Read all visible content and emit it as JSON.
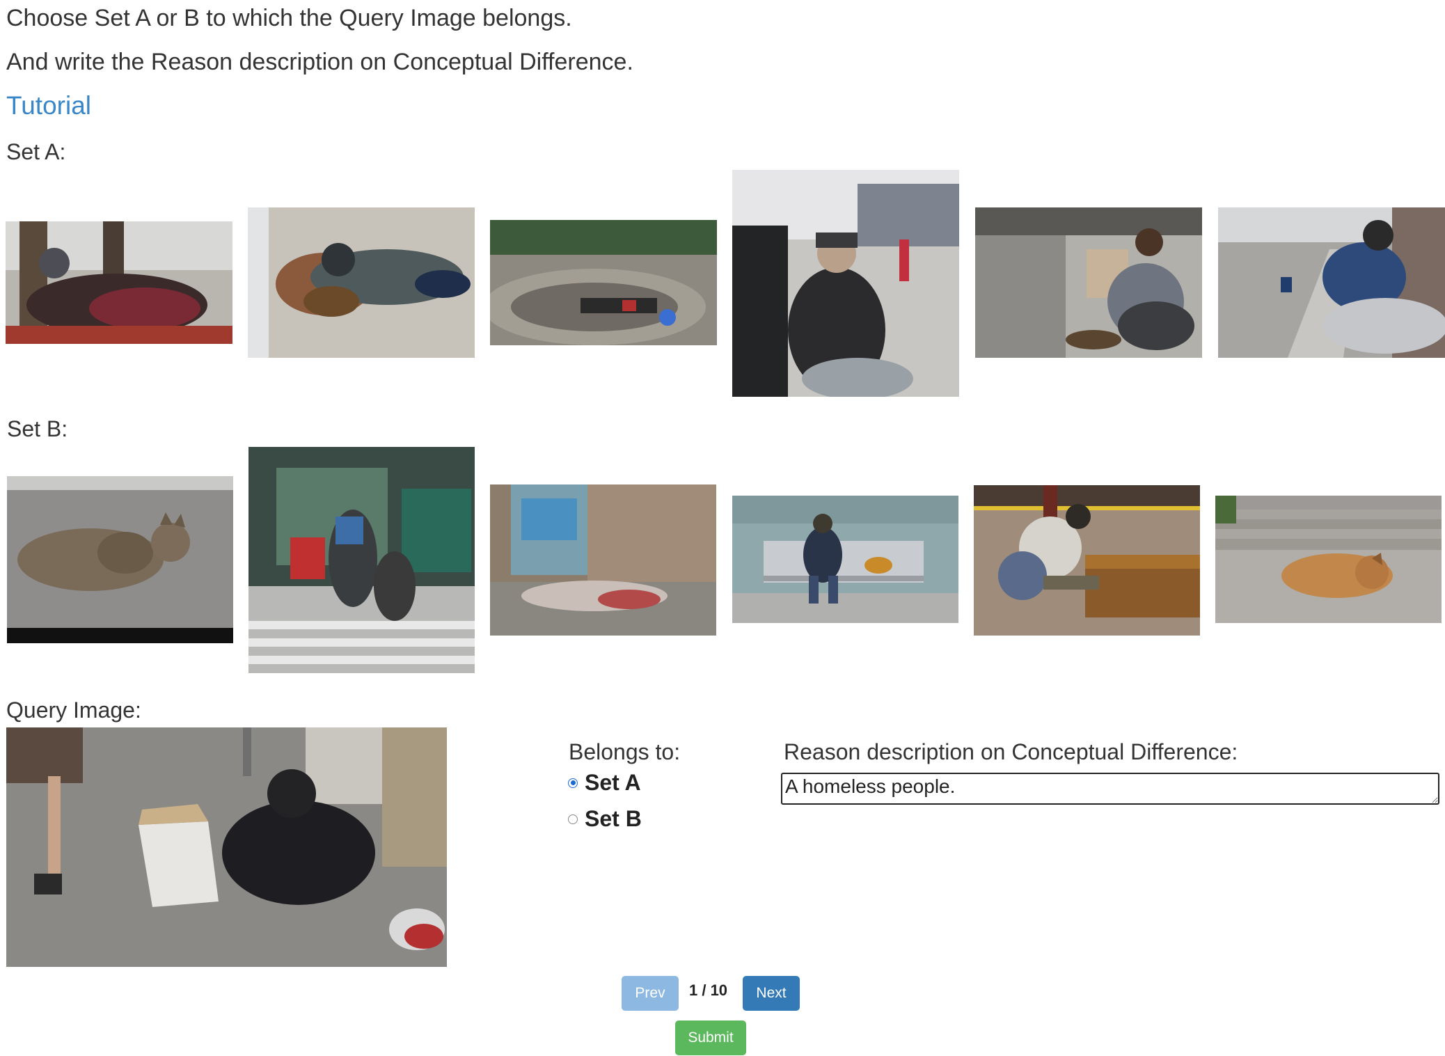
{
  "instructions": {
    "line1": "Choose Set A or B to which the Query Image belongs.",
    "line2": "And write the Reason description on Conceptual Difference.",
    "tutorial_link": "Tutorial"
  },
  "set_a": {
    "label": "Set A:"
  },
  "set_b": {
    "label": "Set B:"
  },
  "query": {
    "label": "Query Image:"
  },
  "belongs_to": {
    "label": "Belongs to:",
    "options": [
      {
        "label": "Set A",
        "checked": true
      },
      {
        "label": "Set B",
        "checked": false
      }
    ]
  },
  "reason": {
    "label": "Reason description on Conceptual Difference:",
    "value": "A homeless people."
  },
  "pagination": {
    "prev_label": "Prev",
    "page_indicator": "1 / 10",
    "next_label": "Next"
  },
  "submit_label": "Submit",
  "colors": {
    "link": "#3a87c8",
    "prev_button": "#8cb8e2",
    "next_button": "#337ab7",
    "submit_button": "#5cb85c",
    "radio_selected": "#1b6ad1"
  }
}
